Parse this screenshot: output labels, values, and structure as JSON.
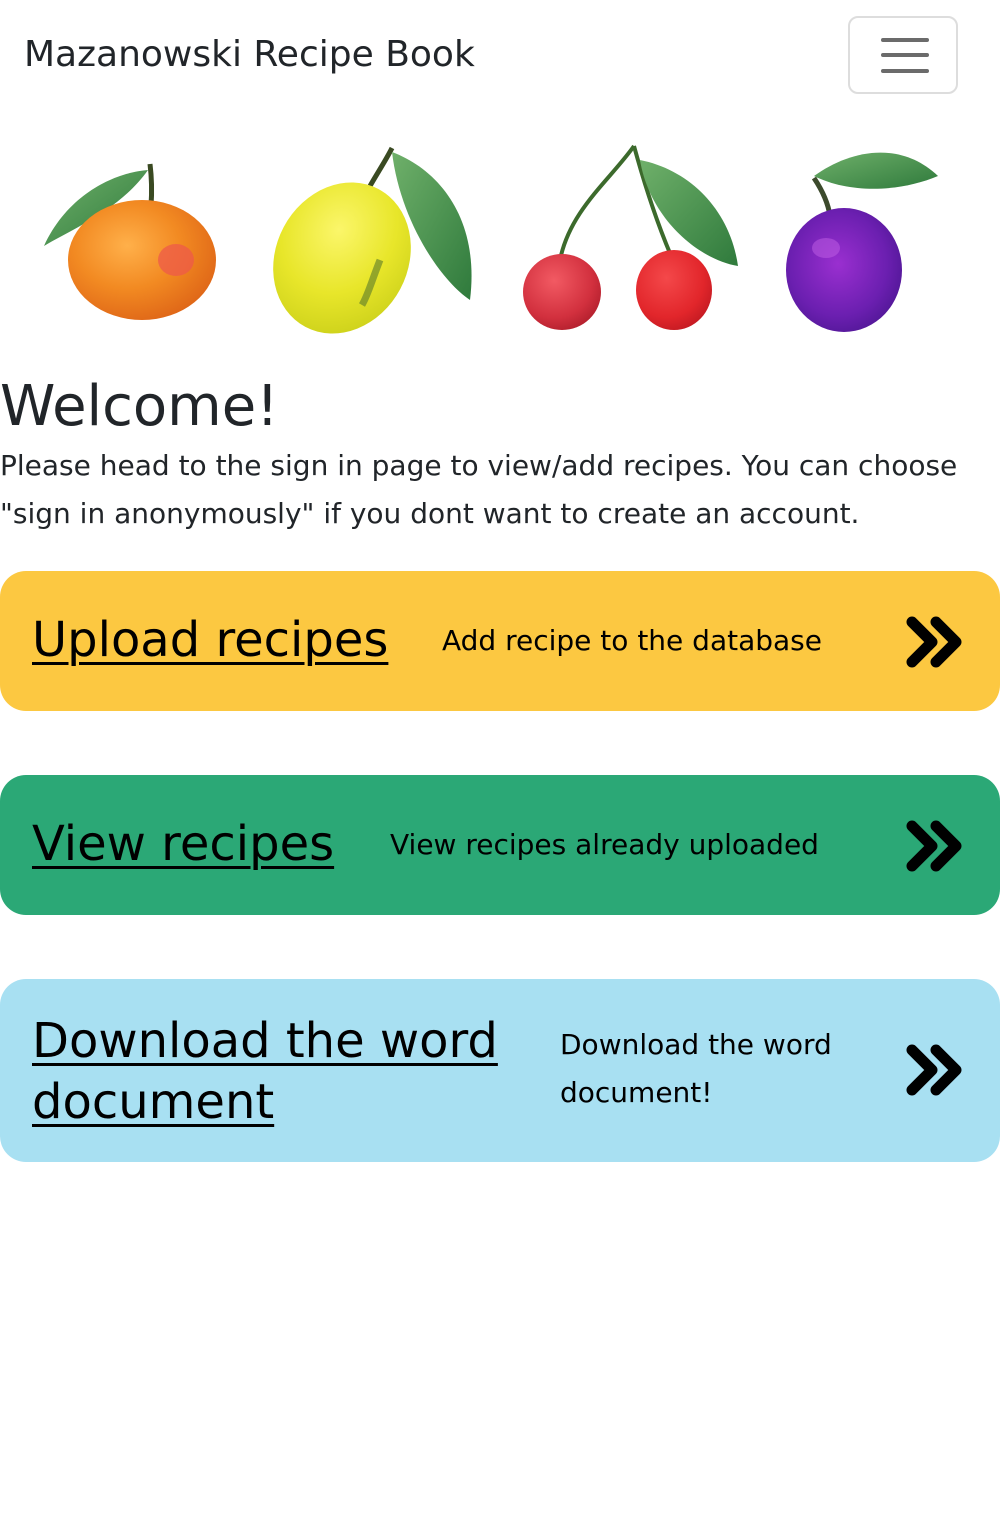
{
  "navbar": {
    "brand": "Mazanowski Recipe Book",
    "menu_icon": "hamburger-menu-icon"
  },
  "banner": {
    "fruits": [
      "orange",
      "lemon",
      "cherries",
      "plum"
    ]
  },
  "welcome": {
    "heading": "Welcome!",
    "text": "Please head to the sign in page to view/add recipes. You can choose \"sign in anonymously\" if you dont want to create an account."
  },
  "cards": [
    {
      "title": "Upload recipes",
      "description": "Add recipe to the database",
      "color": "#fcc841",
      "icon": "double-chevron-right-icon"
    },
    {
      "title": "View recipes",
      "description": "View recipes already uploaded",
      "color": "#2ba876",
      "icon": "double-chevron-right-icon"
    },
    {
      "title": "Download the word document",
      "description": "Download the word document!",
      "color": "#a8e0f2",
      "icon": "double-chevron-right-icon"
    }
  ]
}
